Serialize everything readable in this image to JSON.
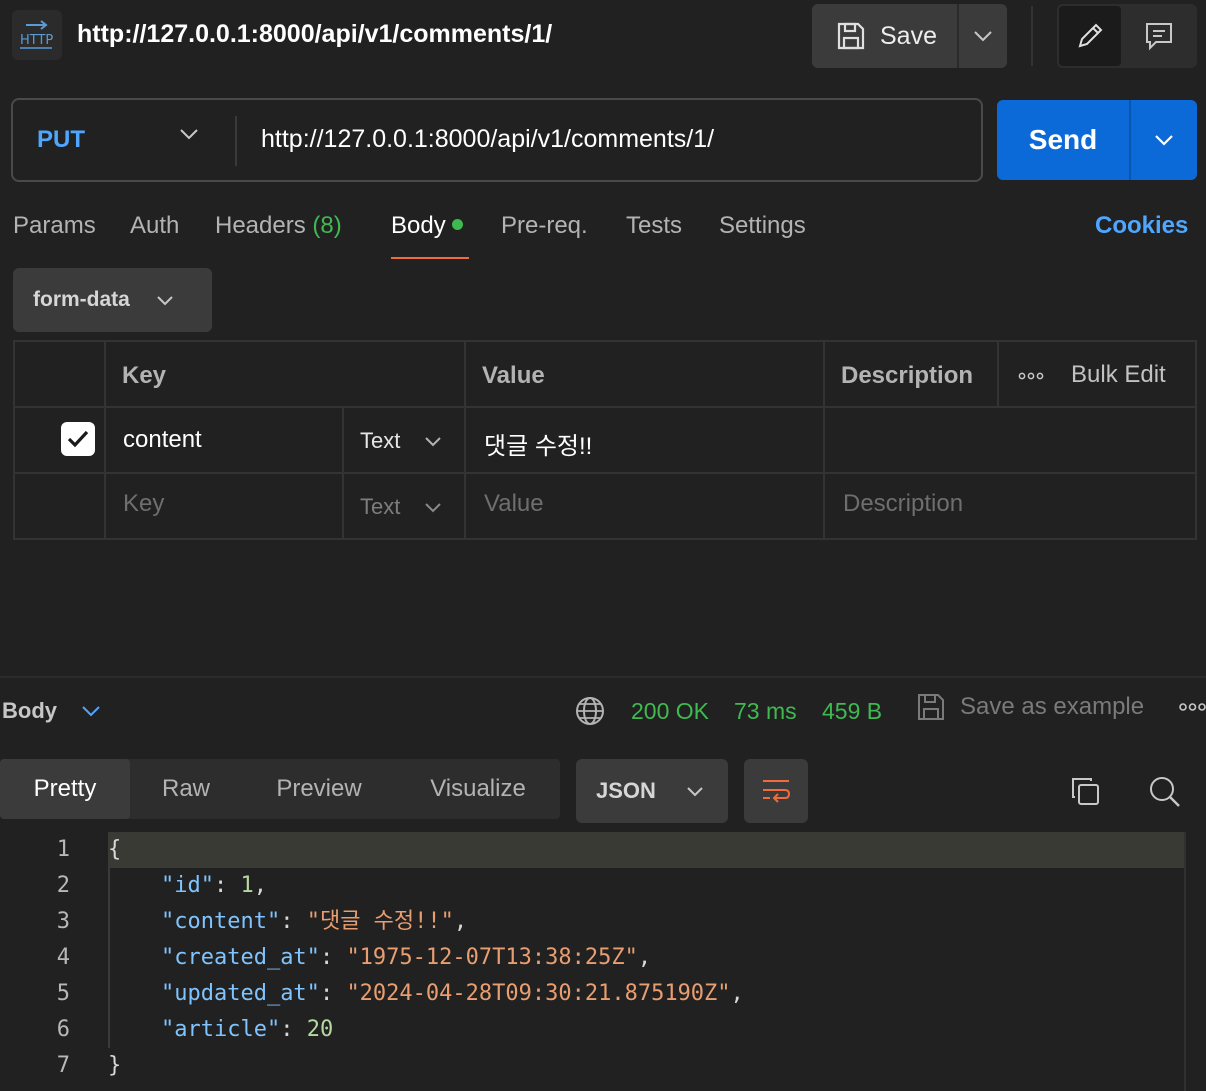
{
  "header": {
    "icon": "http-icon",
    "title": "http://127.0.0.1:8000/api/v1/comments/1/",
    "save_label": "Save"
  },
  "request": {
    "method": "PUT",
    "url": "http://127.0.0.1:8000/api/v1/comments/1/",
    "send_label": "Send"
  },
  "tabs": {
    "params": "Params",
    "auth": "Auth",
    "headers": "Headers",
    "headers_count": "(8)",
    "body": "Body",
    "prereq": "Pre-req.",
    "tests": "Tests",
    "settings": "Settings",
    "cookies": "Cookies"
  },
  "body_type": "form-data",
  "form_table": {
    "headers": {
      "key": "Key",
      "value": "Value",
      "description": "Description",
      "bulk_edit": "Bulk Edit"
    },
    "rows": [
      {
        "checked": true,
        "key": "content",
        "type": "Text",
        "value": "댓글 수정!!",
        "description": ""
      }
    ],
    "placeholder": {
      "key": "Key",
      "type": "Text",
      "value": "Value",
      "description": "Description"
    }
  },
  "response": {
    "section_label": "Body",
    "status": "200 OK",
    "time": "73 ms",
    "size": "459 B",
    "save_example": "Save as example",
    "view_tabs": [
      "Pretty",
      "Raw",
      "Preview",
      "Visualize"
    ],
    "active_view": "Pretty",
    "format": "JSON",
    "code_lines": [
      {
        "n": "1",
        "text": "{"
      },
      {
        "n": "2",
        "key": "\"id\"",
        "value": "1",
        "vtype": "num",
        "comma": ","
      },
      {
        "n": "3",
        "key": "\"content\"",
        "value": "\"댓글 수정!!\"",
        "vtype": "str",
        "comma": ","
      },
      {
        "n": "4",
        "key": "\"created_at\"",
        "value": "\"1975-12-07T13:38:25Z\"",
        "vtype": "str",
        "comma": ","
      },
      {
        "n": "5",
        "key": "\"updated_at\"",
        "value": "\"2024-04-28T09:30:21.875190Z\"",
        "vtype": "str",
        "comma": ","
      },
      {
        "n": "6",
        "key": "\"article\"",
        "value": "20",
        "vtype": "num",
        "comma": ""
      },
      {
        "n": "7",
        "text": "}"
      }
    ]
  },
  "colors": {
    "accent_blue": "#0c6ad8",
    "method_blue": "#4ea6ff",
    "status_green": "#3fb950",
    "tab_underline": "#f26b3a"
  }
}
